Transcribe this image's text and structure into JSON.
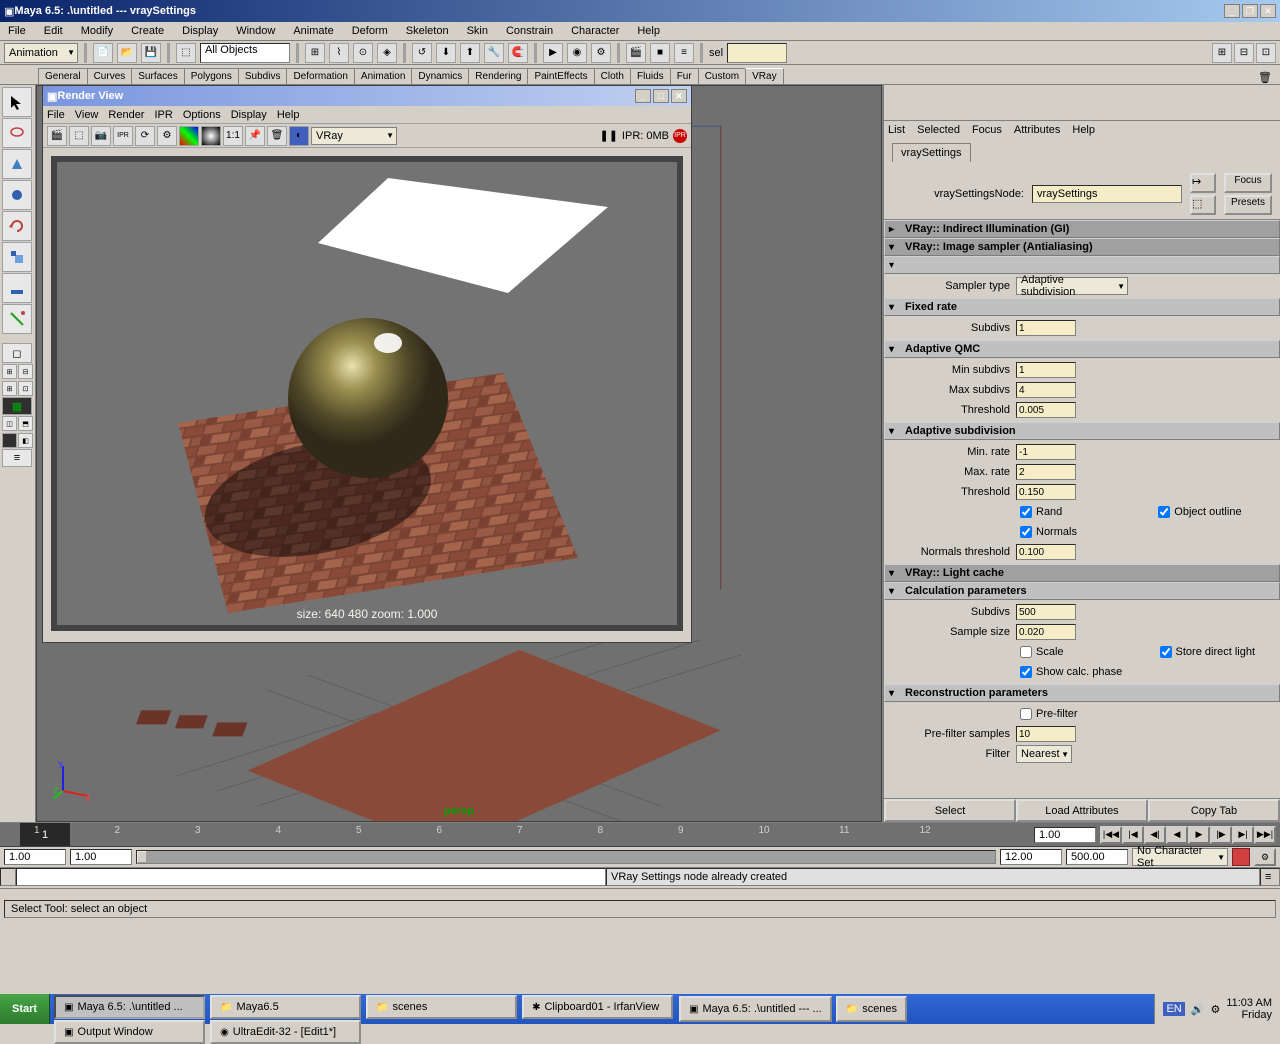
{
  "titlebar": {
    "text": "Maya 6.5: .\\untitled  ---  vraySettings"
  },
  "menubar": [
    "File",
    "Edit",
    "Modify",
    "Create",
    "Display",
    "Window",
    "Animate",
    "Deform",
    "Skeleton",
    "Skin",
    "Constrain",
    "Character",
    "Help"
  ],
  "shelf": {
    "mode": "Animation",
    "allObjects": "All Objects",
    "selLabel": "sel"
  },
  "shelfTabs": [
    "General",
    "Curves",
    "Surfaces",
    "Polygons",
    "Subdivs",
    "Deformation",
    "Animation",
    "Dynamics",
    "Rendering",
    "PaintEffects",
    "Cloth",
    "Fluids",
    "Fur",
    "Custom",
    "VRay"
  ],
  "shelfActiveTab": "VRay",
  "renderView": {
    "title": "Render View",
    "menu": [
      "File",
      "View",
      "Render",
      "IPR",
      "Options",
      "Display",
      "Help"
    ],
    "renderer": "VRay",
    "iprStatus": "IPR: 0MB",
    "status": "size:  640   480  zoom: 1.000"
  },
  "viewport": {
    "label": "persp"
  },
  "ae": {
    "menu": [
      "List",
      "Selected",
      "Focus",
      "Attributes",
      "Help"
    ],
    "tab": "vraySettings",
    "nodeLabel": "vraySettingsNode:",
    "nodeValue": "vraySettings",
    "focusBtn": "Focus",
    "presetsBtn": "Presets",
    "sections": {
      "gi": {
        "title": "VRay:: Indirect Illumination (GI)"
      },
      "imageSampler": {
        "title": "VRay:: Image sampler (Antialiasing)",
        "samplerTypeLabel": "Sampler type",
        "samplerType": "Adaptive subdivision"
      },
      "fixedRate": {
        "title": "Fixed rate",
        "subdivsLabel": "Subdivs",
        "subdivs": "1"
      },
      "adaptiveQMC": {
        "title": "Adaptive QMC",
        "minLabel": "Min subdivs",
        "min": "1",
        "maxLabel": "Max subdivs",
        "max": "4",
        "thresholdLabel": "Threshold",
        "threshold": "0.005"
      },
      "adaptiveSub": {
        "title": "Adaptive subdivision",
        "minRateLabel": "Min. rate",
        "minRate": "-1",
        "maxRateLabel": "Max. rate",
        "maxRate": "2",
        "thresholdLabel": "Threshold",
        "threshold": "0.150",
        "rand": "Rand",
        "normals": "Normals",
        "objectOutline": "Object outline",
        "normalsThresholdLabel": "Normals threshold",
        "normalsThreshold": "0.100"
      },
      "lightCache": {
        "title": "VRay:: Light cache"
      },
      "calcParams": {
        "title": "Calculation parameters",
        "subdivsLabel": "Subdivs",
        "subdivs": "500",
        "sampleSizeLabel": "Sample size",
        "sampleSize": "0.020",
        "scale": "Scale",
        "storeDirect": "Store direct light",
        "showCalc": "Show calc. phase"
      },
      "reconParams": {
        "title": "Reconstruction parameters",
        "preFilter": "Pre-filter",
        "preFilterSamplesLabel": "Pre-filter samples",
        "preFilterSamples": "10",
        "filterLabel": "Filter",
        "filter": "Nearest"
      }
    },
    "bottomBtns": [
      "Select",
      "Load Attributes",
      "Copy Tab"
    ]
  },
  "timeline": {
    "nums": [
      "1",
      "2",
      "3",
      "4",
      "5",
      "6",
      "7",
      "8",
      "9",
      "10",
      "11",
      "12"
    ],
    "rangeStart": "1.00",
    "rangeEnd": "1.00",
    "playStart": "1.00",
    "playEnd": "12.00",
    "total": "500.00",
    "charSet": "No Character Set"
  },
  "footer": {
    "feedback": "VRay Settings node already created",
    "helpLine": "Select Tool: select an object"
  },
  "taskbar": {
    "start": "Start",
    "items": [
      "Maya 6.5: .\\untitled ...",
      "Maya6.5",
      "scenes",
      "Clipboard01 - IrfanView",
      "Maya 6.5: .\\untitled  --- ...",
      "scenes",
      "Output Window",
      "UltraEdit-32 - [Edit1*]"
    ],
    "lang": "EN",
    "time": "11:03 AM",
    "day": "Friday"
  }
}
